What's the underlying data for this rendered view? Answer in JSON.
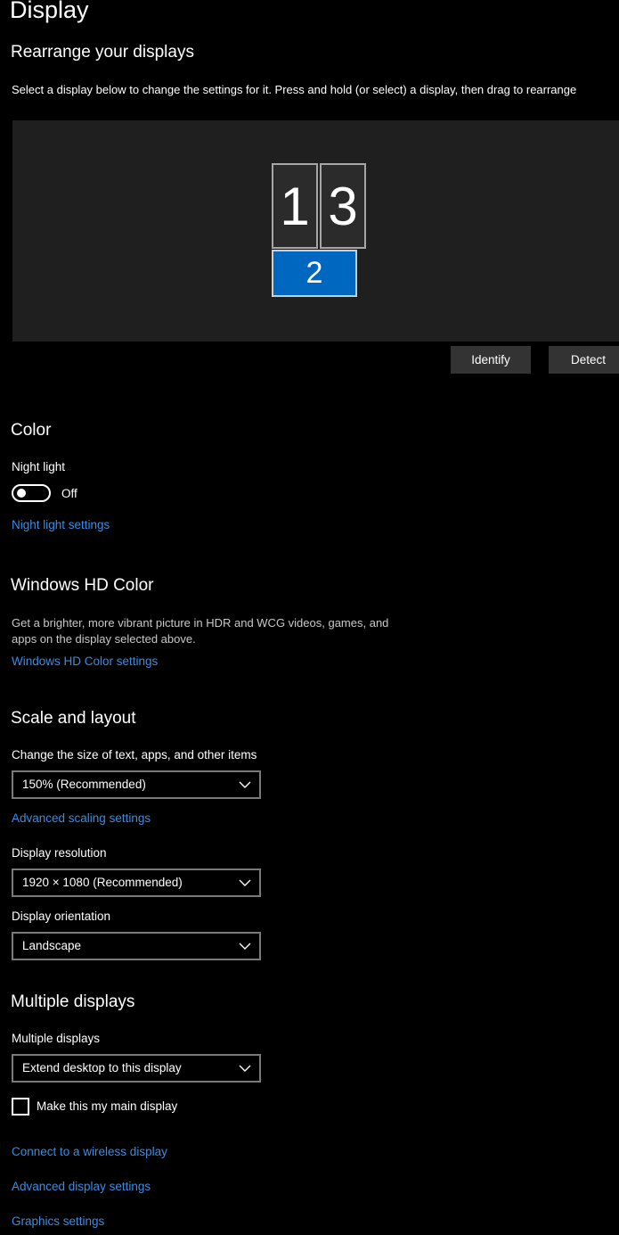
{
  "page": {
    "title": "Display"
  },
  "arrange": {
    "heading": "Rearrange your displays",
    "instruction": "Select a display below to change the settings for it. Press and hold (or select) a display, then drag to rearrange",
    "monitors": [
      {
        "label": "1",
        "selected": false
      },
      {
        "label": "3",
        "selected": false
      },
      {
        "label": "2",
        "selected": true
      }
    ],
    "identify_label": "Identify",
    "detect_label": "Detect"
  },
  "color": {
    "heading": "Color",
    "night_light_label": "Night light",
    "night_light_state": "Off",
    "night_light_settings_link": "Night light settings"
  },
  "hd_color": {
    "heading": "Windows HD Color",
    "description": "Get a brighter, more vibrant picture in HDR and WCG videos, games, and apps on the display selected above.",
    "settings_link": "Windows HD Color settings"
  },
  "scale_layout": {
    "heading": "Scale and layout",
    "scale_label": "Change the size of text, apps, and other items",
    "scale_value": "150% (Recommended)",
    "advanced_scaling_link": "Advanced scaling settings",
    "resolution_label": "Display resolution",
    "resolution_value": "1920 × 1080 (Recommended)",
    "orientation_label": "Display orientation",
    "orientation_value": "Landscape"
  },
  "multiple_displays": {
    "heading": "Multiple displays",
    "label": "Multiple displays",
    "value": "Extend desktop to this display",
    "main_display_checkbox_label": "Make this my main display",
    "main_display_checked": false
  },
  "links": {
    "wireless": "Connect to a wireless display",
    "advanced_display": "Advanced display settings",
    "graphics": "Graphics settings"
  },
  "colors": {
    "background": "#000000",
    "link": "#3b8ce3",
    "selected_monitor": "#0067c0",
    "monitor": "#2b2b2b",
    "button": "#333333"
  }
}
